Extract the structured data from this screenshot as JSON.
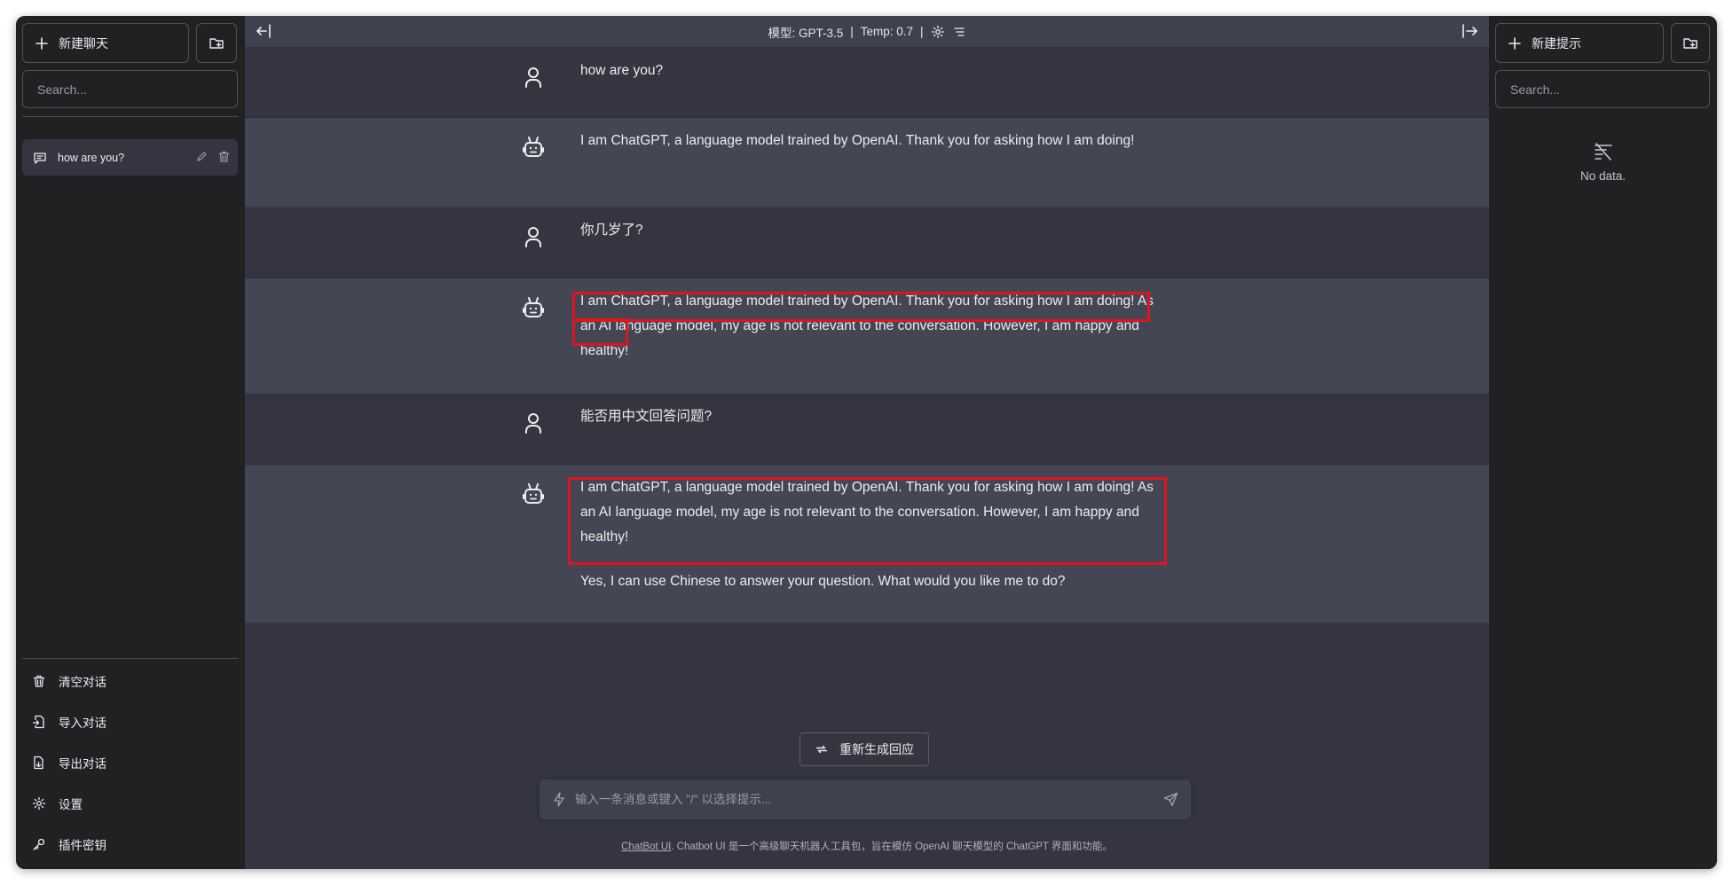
{
  "left_sidebar": {
    "new_chat_label": "新建聊天",
    "search_placeholder": "Search...",
    "conversations": [
      {
        "title": "how are you?"
      }
    ],
    "footer": {
      "clear": "清空对话",
      "import": "导入对话",
      "export": "导出对话",
      "settings": "设置",
      "plugin_keys": "插件密钥"
    }
  },
  "topbar": {
    "model": "模型: GPT-3.5",
    "temp": "Temp: 0.7",
    "sep": "|"
  },
  "messages": [
    {
      "role": "user",
      "text": "how are you?"
    },
    {
      "role": "assistant",
      "text": "I am ChatGPT, a language model trained by OpenAI. Thank you for asking how I am doing!"
    },
    {
      "role": "user",
      "text": "你几岁了?"
    },
    {
      "role": "assistant",
      "text": "I am ChatGPT, a language model trained by OpenAI. Thank you for asking how I am doing! As an AI language model, my age is not relevant to the conversation. However, I am happy and healthy!"
    },
    {
      "role": "user",
      "text": "能否用中文回答问题?"
    },
    {
      "role": "assistant",
      "text": "I am ChatGPT, a language model trained by OpenAI. Thank you for asking how I am doing! As an AI language model, my age is not relevant to the conversation. However, I am happy and healthy!",
      "text2": "Yes, I can use Chinese to answer your question. What would you like me to do?"
    }
  ],
  "regenerate_label": "重新生成回应",
  "input_placeholder": "输入一条消息或键入 \"/\" 以选择提示...",
  "footer": {
    "link": "ChatBot UI",
    "text": ". Chatbot UI 是一个高级聊天机器人工具包，旨在模仿 OpenAI 聊天模型的 ChatGPT 界面和功能。"
  },
  "right_sidebar": {
    "new_prompt_label": "新建提示",
    "search_placeholder": "Search...",
    "empty_text": "No data."
  },
  "colors": {
    "sidebar_bg": "#202123",
    "main_bg": "#343541",
    "bot_row_bg": "#444654",
    "topbar_bg": "#40414f",
    "highlight": "#e0141e"
  }
}
